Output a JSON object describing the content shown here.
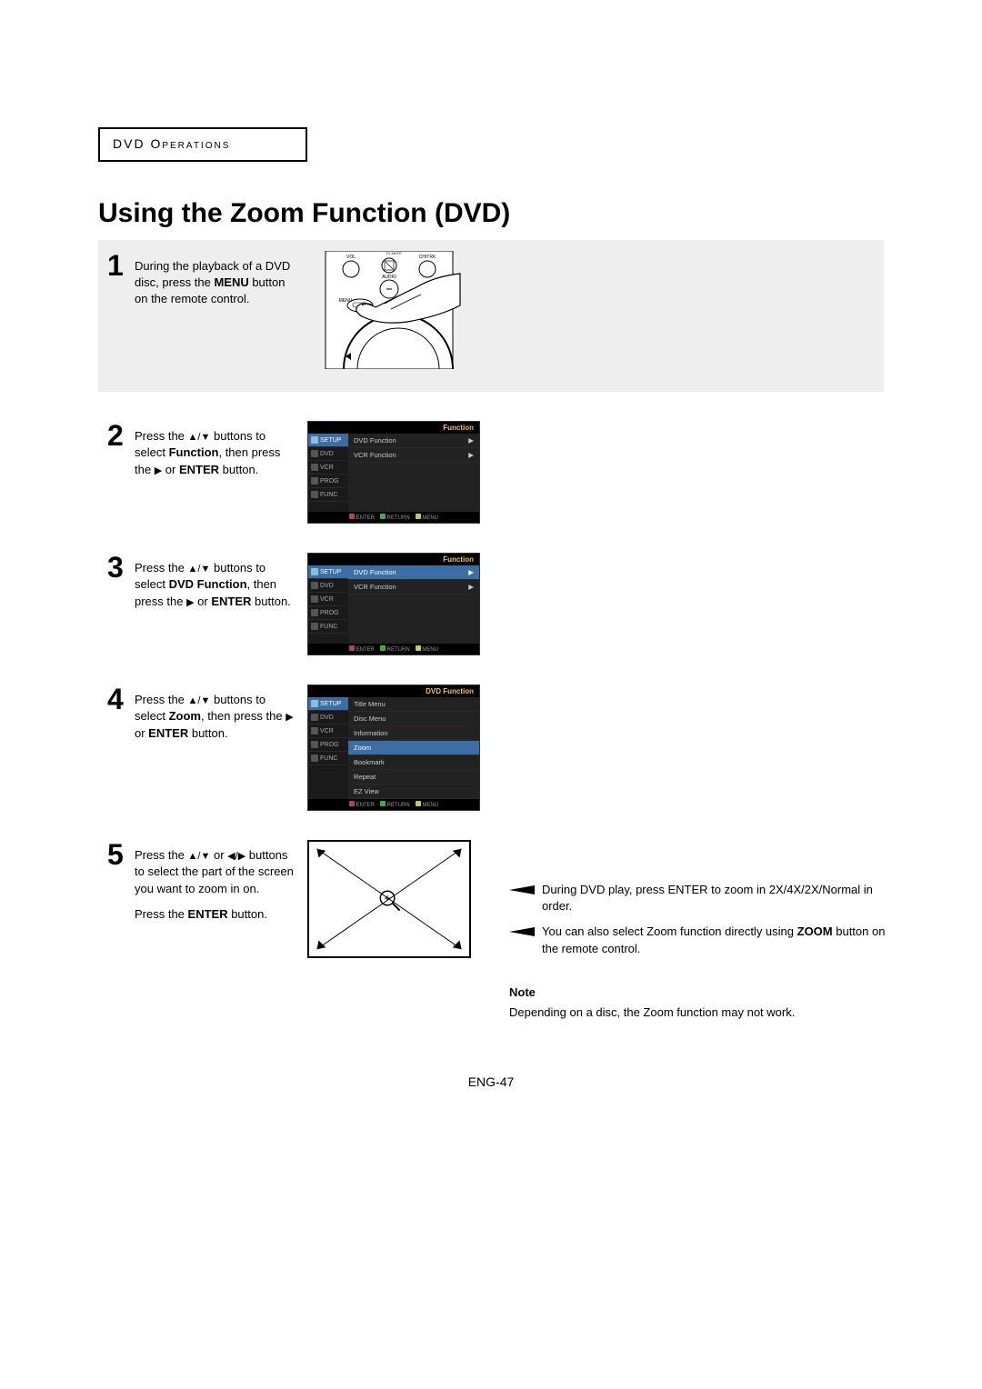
{
  "section_label": "DVD Operations",
  "title": "Using the Zoom Function (DVD)",
  "step1": {
    "num": "1",
    "text_a": "During the playback of a DVD disc, press the ",
    "bold_a": "MENU",
    "text_b": " button on the remote control.",
    "remote": {
      "vol": "VOL",
      "chtrk": "CH/TRK",
      "audio": "AUDIO",
      "menu": "MENU",
      "tvmute": "TV MUTE"
    }
  },
  "step2": {
    "num": "2",
    "pre": "Press the ",
    "mid": " buttons to select ",
    "b1": "Function",
    "mid2": ", then press the ",
    "mid3": " or ",
    "b2": "ENTER",
    "post": " button.",
    "menu": {
      "header": "Function",
      "side": [
        "SETUP",
        "DVD",
        "VCR",
        "PROG",
        "FUNC"
      ],
      "active": "SETUP",
      "items": [
        "DVD Function",
        "VCR Function"
      ],
      "hl": "",
      "footer": [
        "ENTER",
        "RETURN",
        "MENU"
      ]
    }
  },
  "step3": {
    "num": "3",
    "pre": "Press the ",
    "mid": " buttons to select ",
    "b1": "DVD Function",
    "mid2": ", then press the ",
    "mid3": " or ",
    "b2": "ENTER",
    "post": " button.",
    "menu": {
      "header": "Function",
      "side": [
        "SETUP",
        "DVD",
        "VCR",
        "PROG",
        "FUNC"
      ],
      "active": "SETUP",
      "items": [
        "DVD Function",
        "VCR Function"
      ],
      "hl": "DVD Function",
      "footer": [
        "ENTER",
        "RETURN",
        "MENU"
      ]
    }
  },
  "step4": {
    "num": "4",
    "pre": "Press the ",
    "mid": " buttons to select ",
    "b1": "Zoom",
    "mid2": ", then press the ",
    "mid3": " or ",
    "b2": "ENTER",
    "post": " button.",
    "menu": {
      "header": "DVD Function",
      "side": [
        "SETUP",
        "DVD",
        "VCR",
        "PROG",
        "FUNC"
      ],
      "active": "SETUP",
      "items": [
        "Title Menu",
        "Disc Menu",
        "Information",
        "Zoom",
        "Bookmark",
        "Repeat",
        "EZ View"
      ],
      "hl": "Zoom",
      "footer": [
        "ENTER",
        "RETURN",
        "MENU"
      ]
    }
  },
  "step5": {
    "num": "5",
    "pre": "Press the ",
    "mid_or": " or ",
    "mid": " buttons to select the part of the screen you want to zoom in on.",
    "line2_pre": "Press the ",
    "line2_b": "ENTER",
    "line2_post": " button."
  },
  "sidenotes": {
    "b1": "During DVD play, press ENTER to zoom in 2X/4X/2X/Normal in order.",
    "b2_a": "You can also select Zoom function directly using ",
    "b2_bold": "ZOOM",
    "b2_b": " button on the remote control.",
    "note_head": "Note",
    "note_body": "Depending on a disc, the Zoom function may not work."
  },
  "page_number": "ENG-47"
}
